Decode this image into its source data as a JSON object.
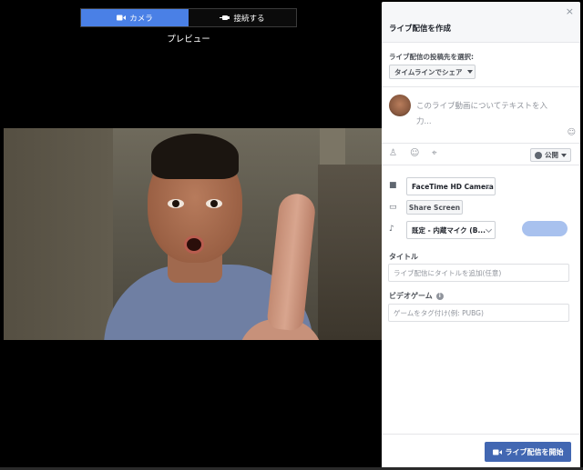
{
  "tabs": [
    {
      "label": "カメラ",
      "icon": "video-camera-icon",
      "active": true
    },
    {
      "label": "接続する",
      "icon": "connect-icon",
      "active": false
    }
  ],
  "preview_label": "プレビュー",
  "panel": {
    "title": "ライブ配信を作成",
    "close_icon": "×",
    "destination_label": "ライブ配信の投稿先を選択:",
    "destination_value": "タイムラインでシェア",
    "compose_placeholder": "このライブ動画についてテキストを入力...",
    "audience_label": "公開",
    "camera_device": "FaceTime HD Camera",
    "share_screen_label": "Share Screen",
    "mic_device": "既定 - 内蔵マイク (B...",
    "title_label": "タイトル",
    "title_placeholder": "ライブ配信にタイトルを追加(任意)",
    "game_label": "ビデオゲーム",
    "game_placeholder": "ゲームをタグ付け(例: PUBG)",
    "go_live_label": "ライブ配信を開始"
  },
  "colors": {
    "accent": "#4a80e6",
    "primary_button": "#4267b2",
    "level_meter": "#a8c1ee"
  }
}
